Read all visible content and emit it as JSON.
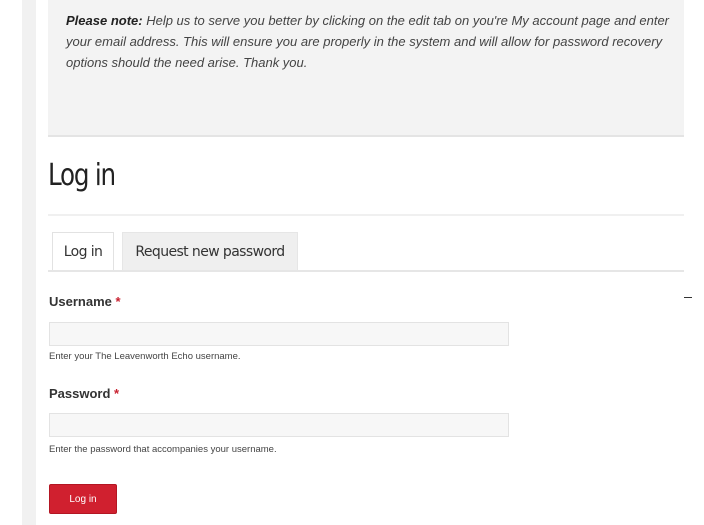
{
  "notice": {
    "lead": "Please note:",
    "text": " Help us to serve you better by clicking on the edit tab on you're My account page and enter your email address. This will ensure you are properly in the system and will allow for password recovery options should the need arise. Thank you."
  },
  "page": {
    "title": "Log in"
  },
  "tabs": [
    {
      "label": "Log in",
      "active": true
    },
    {
      "label": "Request new password",
      "active": false
    }
  ],
  "form": {
    "username": {
      "label": "Username",
      "required_mark": "*",
      "value": "",
      "description": "Enter your The Leavenworth Echo username."
    },
    "password": {
      "label": "Password",
      "required_mark": "*",
      "value": "",
      "description": "Enter the password that accompanies your username."
    },
    "submit_label": "Log in"
  },
  "colors": {
    "accent": "#d0202f",
    "required": "#c8202f"
  }
}
